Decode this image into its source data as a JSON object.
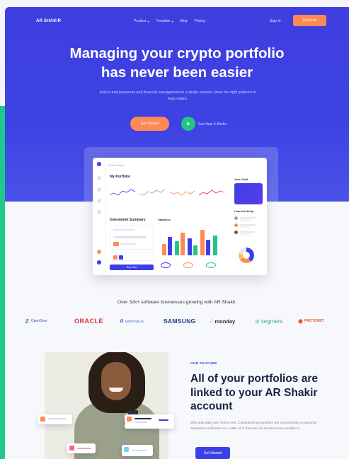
{
  "colors": {
    "brand_blue": "#3d43e3",
    "accent_orange": "#ff8a55",
    "accent_green": "#22c684",
    "strip_green": "#1ec98b"
  },
  "nav": {
    "logo": "AR SHAKIR",
    "links": [
      {
        "label": "Product",
        "has_dropdown": true
      },
      {
        "label": "Template",
        "has_dropdown": true
      },
      {
        "label": "Blog",
        "has_dropdown": false
      },
      {
        "label": "Pricing",
        "has_dropdown": false
      }
    ],
    "signin": "Sign In",
    "cta": "Get Free"
  },
  "hero": {
    "title_line1": "Managing your crypto portfolio",
    "title_line2": "has never been easier",
    "subtitle": "End-to-end payments and financial management in a single solution. Meet the right platform to help realize.",
    "primary_cta": "Get Started",
    "secondary_cta": "See How It Works",
    "secondary_icon": "play-icon"
  },
  "dashboard": {
    "search_placeholder": "Search here",
    "portfolio_title": "My Portfolio",
    "investment_title": "Investment Summary",
    "statistics_title": "Statistics",
    "top_card_title": "Your Card",
    "recent_title": "Latest Activity",
    "btn_label": "Buy Now"
  },
  "trusted": {
    "text": "Over 32k+ software businesses growing with AR Shakir.",
    "brands": [
      {
        "name": "OpenDoor",
        "icon": "opendoor-icon",
        "color": "#3b4ca8"
      },
      {
        "name": "ORACLE",
        "icon": "",
        "color": "#e0313a"
      },
      {
        "name": "MORPHEUS",
        "icon": "morpheus-icon",
        "color": "#3b5ad0"
      },
      {
        "name": "SAMSUNG",
        "icon": "",
        "color": "#1f3b8a"
      },
      {
        "name": "monday",
        "icon": "monday-icon",
        "color": "#2a2e3d"
      },
      {
        "name": "segment",
        "icon": "segment-icon",
        "color": "#34b38a"
      },
      {
        "name": "PROTONET",
        "icon": "protonet-icon",
        "color": "#f0562c"
      }
    ]
  },
  "feature": {
    "eyebrow": "OUR FEATURE",
    "title_line1": "All of your portfolios are",
    "title_line2": "linked to your AR Shakir",
    "title_line3": "account",
    "body": "Why wait daily over home rent. Considered sympathize ten uncommonly occasional assistance sufficient not. Letter of on become he tended active enable to.",
    "cta": "Get Started"
  }
}
